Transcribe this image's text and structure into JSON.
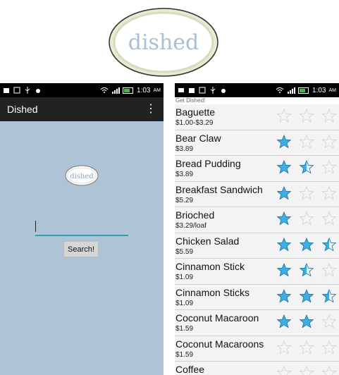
{
  "logo": {
    "text": "dished"
  },
  "left_phone": {
    "status_time": "1:03",
    "status_ampm": "AM",
    "app_title": "Dished",
    "logo_text": "dished",
    "search": {
      "value": "",
      "placeholder": ""
    },
    "search_button": "Search!"
  },
  "right_phone": {
    "status_time": "1:03",
    "status_ampm": "AM",
    "subtitle": "Get Dished!",
    "items": [
      {
        "name": "Baguette",
        "price": "$1.00-$3.29",
        "rating": 0
      },
      {
        "name": "Bear Claw",
        "price": "$3.89",
        "rating": 1
      },
      {
        "name": "Bread Pudding",
        "price": "$3.89",
        "rating": 1.5
      },
      {
        "name": "Breakfast Sandwich",
        "price": "$5.29",
        "rating": 1
      },
      {
        "name": "Brioched",
        "price": "$3.29/loaf",
        "rating": 1
      },
      {
        "name": "Chicken Salad",
        "price": "$5.59",
        "rating": 2.5
      },
      {
        "name": "Cinnamon Stick",
        "price": "$1.09",
        "rating": 1.5
      },
      {
        "name": "Cinnamon Sticks",
        "price": "$1.09",
        "rating": 2.5
      },
      {
        "name": "Coconut Macaroon",
        "price": "$1.59",
        "rating": 2
      },
      {
        "name": "Coconut Macaroons",
        "price": "$1.59",
        "rating": 0
      },
      {
        "name": "Coffee",
        "price": "",
        "rating": 0
      }
    ]
  },
  "colors": {
    "accent": "#2aa5a5",
    "background": "#aec3d5",
    "star_fill": "#3ab0e6"
  }
}
